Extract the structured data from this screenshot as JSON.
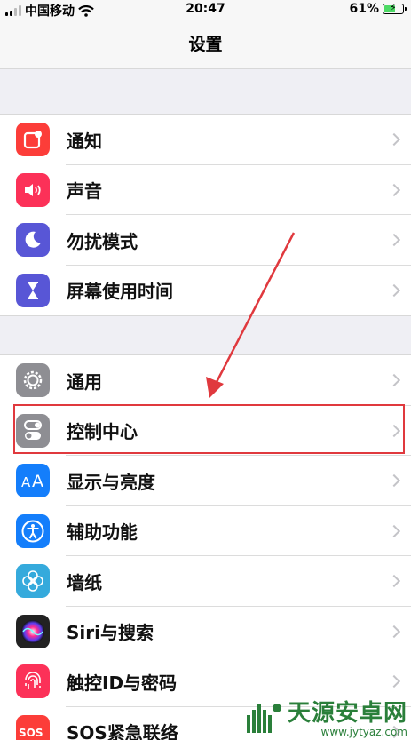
{
  "status_bar": {
    "carrier": "中国移动",
    "time": "20:47",
    "battery": "61%",
    "battery_level": 0.61
  },
  "nav": {
    "title": "设置"
  },
  "sections": [
    {
      "items": [
        {
          "label": "通知",
          "icon": "notifications-icon",
          "color": "#fc3d39"
        },
        {
          "label": "声音",
          "icon": "sound-icon",
          "color": "#fc3158"
        },
        {
          "label": "勿扰模式",
          "icon": "moon-icon",
          "color": "#5856d6"
        },
        {
          "label": "屏幕使用时间",
          "icon": "hourglass-icon",
          "color": "#5856d6"
        }
      ]
    },
    {
      "items": [
        {
          "label": "通用",
          "icon": "gear-icon",
          "color": "#8e8e93"
        },
        {
          "label": "控制中心",
          "icon": "toggles-icon",
          "color": "#8e8e93"
        },
        {
          "label": "显示与亮度",
          "icon": "text-size-icon",
          "color": "#147efb"
        },
        {
          "label": "辅助功能",
          "icon": "accessibility-icon",
          "color": "#147efb"
        },
        {
          "label": "墙纸",
          "icon": "flower-icon",
          "color": "#35aadc"
        },
        {
          "label": "Siri与搜索",
          "icon": "siri-icon",
          "color": "#222222"
        },
        {
          "label": "触控ID与密码",
          "icon": "fingerprint-icon",
          "color": "#fc3158"
        },
        {
          "label": "SOS紧急联络",
          "icon": "sos-icon",
          "color": "#fc3d39"
        }
      ]
    }
  ],
  "annotation": {
    "highlight_color": "#e0393e"
  },
  "watermark": {
    "text": "天源安卓网",
    "url": "www.jytyaz.com"
  }
}
